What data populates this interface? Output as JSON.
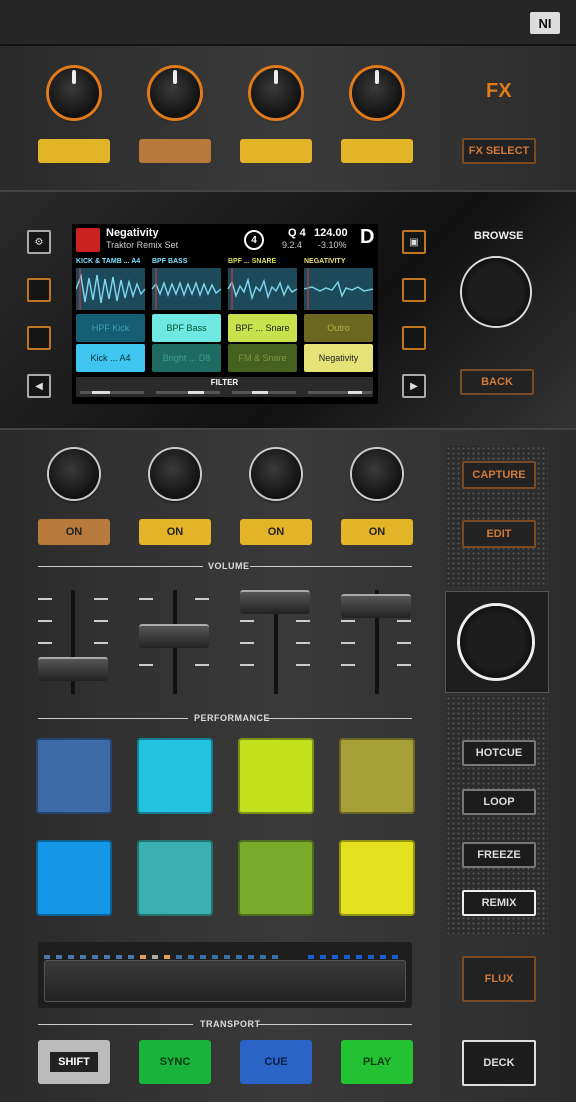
{
  "logo": "NI",
  "fx": {
    "label": "FX",
    "select_label": "FX SELECT",
    "buttons": [
      {
        "color": "#e4b428"
      },
      {
        "color": "#b87a3c"
      },
      {
        "color": "#e4b428"
      },
      {
        "color": "#e4b428"
      }
    ]
  },
  "browse": {
    "label": "BROWSE",
    "back_label": "BACK"
  },
  "display": {
    "track_title": "Negativity",
    "track_subtitle": "Traktor Remix Set",
    "deck_number": "4",
    "quantize": "Q 4",
    "quantize_value": "9.2.4",
    "bpm": "124.00",
    "tempo_offset": "-3.10%",
    "deck_letter": "D",
    "slot_headers": [
      "KICK & TAMB ... A4",
      "BPF BASS",
      "BPF ... SNARE",
      "NEGATIVITY"
    ],
    "cells_row1": [
      "HPF Kick",
      "BPF Bass",
      "BPF ... Snare",
      "Outro"
    ],
    "cells_row2": [
      "Kick ... A4",
      "Bright ... D8",
      "FM & Snare",
      "Negativity"
    ],
    "filter_label": "FILTER"
  },
  "slots": {
    "on_label": "ON",
    "on_colors": [
      "#b87a3c",
      "#e4b428",
      "#e4b428",
      "#e4b428"
    ],
    "volume_label": "VOLUME",
    "fader_levels": [
      0.15,
      0.55,
      0.95,
      0.9
    ]
  },
  "side": {
    "capture_label": "CAPTURE",
    "edit_label": "EDIT",
    "hotcue_label": "HOTCUE",
    "loop_label": "LOOP",
    "freeze_label": "FREEZE",
    "remix_label": "REMIX",
    "flux_label": "FLUX",
    "deck_label": "DECK"
  },
  "performance": {
    "label": "PERFORMANCE",
    "pad_colors": [
      "#3d6ba8",
      "#22c4e0",
      "#c2e01e",
      "#a7a038",
      "#1497e6",
      "#3ab0b0",
      "#7aaa2a",
      "#e4e21e"
    ]
  },
  "transport": {
    "label": "TRANSPORT",
    "shift_label": "SHIFT",
    "sync_label": "SYNC",
    "cue_label": "CUE",
    "play_label": "PLAY"
  }
}
